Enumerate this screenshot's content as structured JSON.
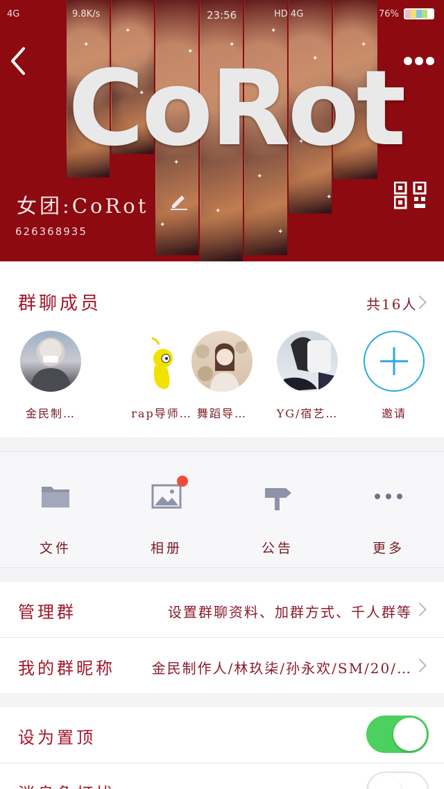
{
  "status_bar": {
    "network_left": "4G",
    "speed": "9.8K/s",
    "time": "23:56",
    "network_right": "HD 4G",
    "battery": "76%"
  },
  "header": {
    "banner_text": "CoRot",
    "group_name": "女团:CoRot",
    "group_id": "626368935",
    "accent_color": "#8c0a10"
  },
  "members": {
    "title": "群聊成员",
    "count": "共16人",
    "items": [
      {
        "name": "金民制…"
      },
      {
        "name": "rap导师…"
      },
      {
        "name": "舞蹈导…"
      },
      {
        "name": "YG/宿艺…"
      },
      {
        "name": "邀请"
      }
    ]
  },
  "tools": [
    {
      "label": "文件",
      "icon": "folder-icon"
    },
    {
      "label": "相册",
      "icon": "image-icon",
      "badge": true
    },
    {
      "label": "公告",
      "icon": "signpost-icon"
    },
    {
      "label": "更多",
      "icon": "more-dots-icon"
    }
  ],
  "rows": {
    "manage": {
      "label": "管理群",
      "value": "设置群聊资料、加群方式、千人群等"
    },
    "nickname": {
      "label": "我的群昵称",
      "value": "金民制作人/林玖柒/孙永欢/SM/20/…"
    },
    "pin": {
      "label": "设为置顶",
      "enabled": true
    },
    "next": {
      "label": "消息免打扰",
      "enabled": false
    }
  },
  "colors": {
    "label_red": "#a3152a",
    "toggle_on": "#4cd05e"
  }
}
